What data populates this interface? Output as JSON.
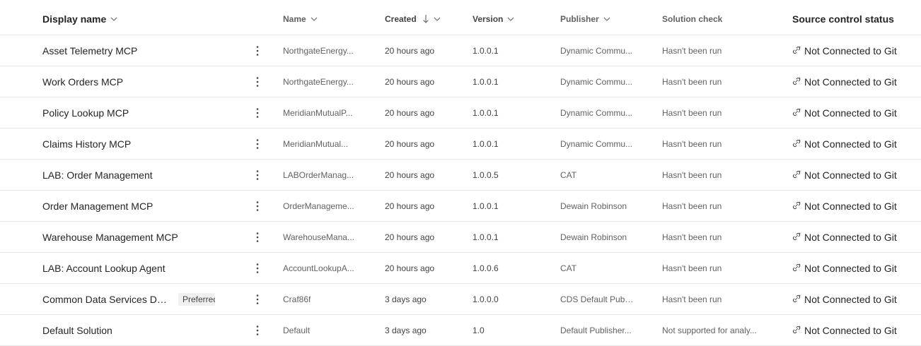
{
  "columns": {
    "display_name": "Display name",
    "name": "Name",
    "created": "Created",
    "version": "Version",
    "publisher": "Publisher",
    "solution_check": "Solution check",
    "source_control": "Source control status"
  },
  "rows": [
    {
      "display_name": "Asset Telemetry MCP",
      "name": "NorthgateEnergy...",
      "created": "20 hours ago",
      "version": "1.0.0.1",
      "publisher": "Dynamic Commu...",
      "solution_check": "Hasn't been run",
      "source_control": "Not Connected to Git",
      "badge": ""
    },
    {
      "display_name": "Work Orders MCP",
      "name": "NorthgateEnergy...",
      "created": "20 hours ago",
      "version": "1.0.0.1",
      "publisher": "Dynamic Commu...",
      "solution_check": "Hasn't been run",
      "source_control": "Not Connected to Git",
      "badge": ""
    },
    {
      "display_name": "Policy Lookup MCP",
      "name": "MeridianMutualP...",
      "created": "20 hours ago",
      "version": "1.0.0.1",
      "publisher": "Dynamic Commu...",
      "solution_check": "Hasn't been run",
      "source_control": "Not Connected to Git",
      "badge": ""
    },
    {
      "display_name": "Claims History MCP",
      "name": "MeridianMutual...",
      "created": "20 hours ago",
      "version": "1.0.0.1",
      "publisher": "Dynamic Commu...",
      "solution_check": "Hasn't been run",
      "source_control": "Not Connected to Git",
      "badge": ""
    },
    {
      "display_name": "LAB: Order Management",
      "name": "LABOrderManag...",
      "created": "20 hours ago",
      "version": "1.0.0.5",
      "publisher": "CAT",
      "solution_check": "Hasn't been run",
      "source_control": "Not Connected to Git",
      "badge": ""
    },
    {
      "display_name": "Order Management MCP",
      "name": "OrderManageme...",
      "created": "20 hours ago",
      "version": "1.0.0.1",
      "publisher": "Dewain Robinson",
      "solution_check": "Hasn't been run",
      "source_control": "Not Connected to Git",
      "badge": ""
    },
    {
      "display_name": "Warehouse Management MCP",
      "name": "WarehouseMana...",
      "created": "20 hours ago",
      "version": "1.0.0.1",
      "publisher": "Dewain Robinson",
      "solution_check": "Hasn't been run",
      "source_control": "Not Connected to Git",
      "badge": ""
    },
    {
      "display_name": "LAB: Account Lookup Agent",
      "name": "AccountLookupA...",
      "created": "20 hours ago",
      "version": "1.0.0.6",
      "publisher": "CAT",
      "solution_check": "Hasn't been run",
      "source_control": "Not Connected to Git",
      "badge": ""
    },
    {
      "display_name": "Common Data Services Def...",
      "name": "Craf86f",
      "created": "3 days ago",
      "version": "1.0.0.0",
      "publisher": "CDS Default Publ...",
      "solution_check": "Hasn't been run",
      "source_control": "Not Connected to Git",
      "badge": "Preferred"
    },
    {
      "display_name": "Default Solution",
      "name": "Default",
      "created": "3 days ago",
      "version": "1.0",
      "publisher": "Default Publisher...",
      "solution_check": "Not supported for analy...",
      "source_control": "Not Connected to Git",
      "badge": ""
    }
  ]
}
